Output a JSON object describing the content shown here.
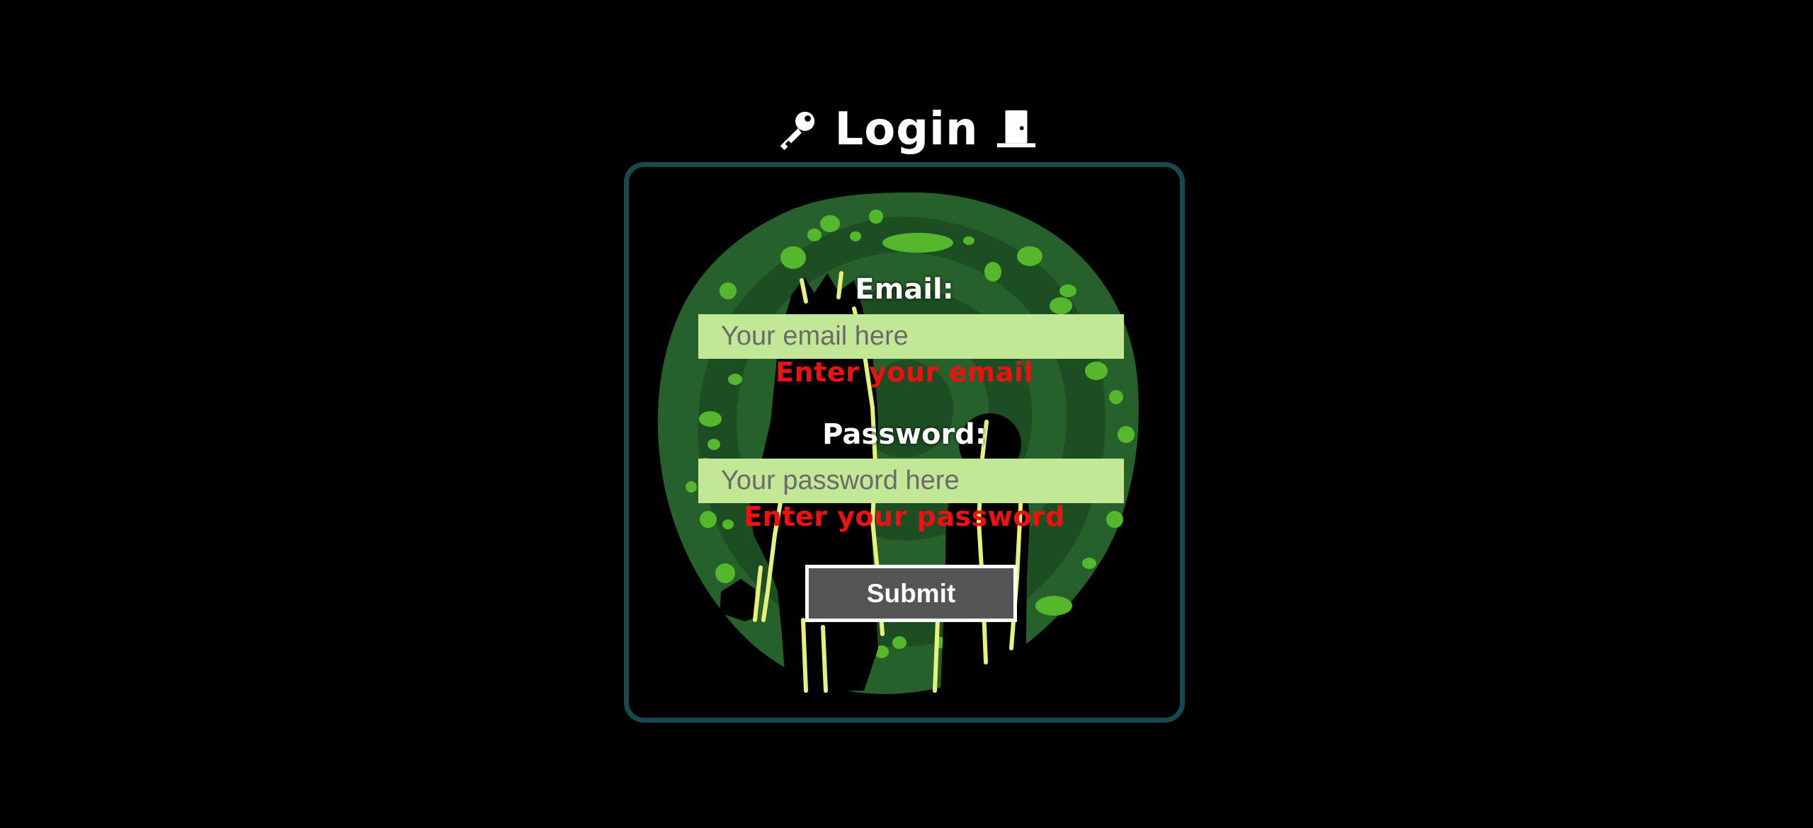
{
  "header": {
    "title": "Login",
    "left_icon": "key-icon",
    "right_icon": "door-icon"
  },
  "form": {
    "email_label": "Email:",
    "email_placeholder": "Your email here",
    "email_value": "",
    "email_error": "Enter your email",
    "password_label": "Password:",
    "password_placeholder": "Your password here",
    "password_value": "",
    "password_error": "Enter your password",
    "submit_label": "Submit"
  },
  "colors": {
    "background": "#000000",
    "card_border": "#174a4e",
    "input_bg": "#c2e795",
    "error": "#ee1111",
    "button_bg": "#555555",
    "portal_dark": "#1d4d22",
    "portal_mid": "#26602b",
    "portal_spot": "#55b82c",
    "highlight": "#e6f07a"
  }
}
